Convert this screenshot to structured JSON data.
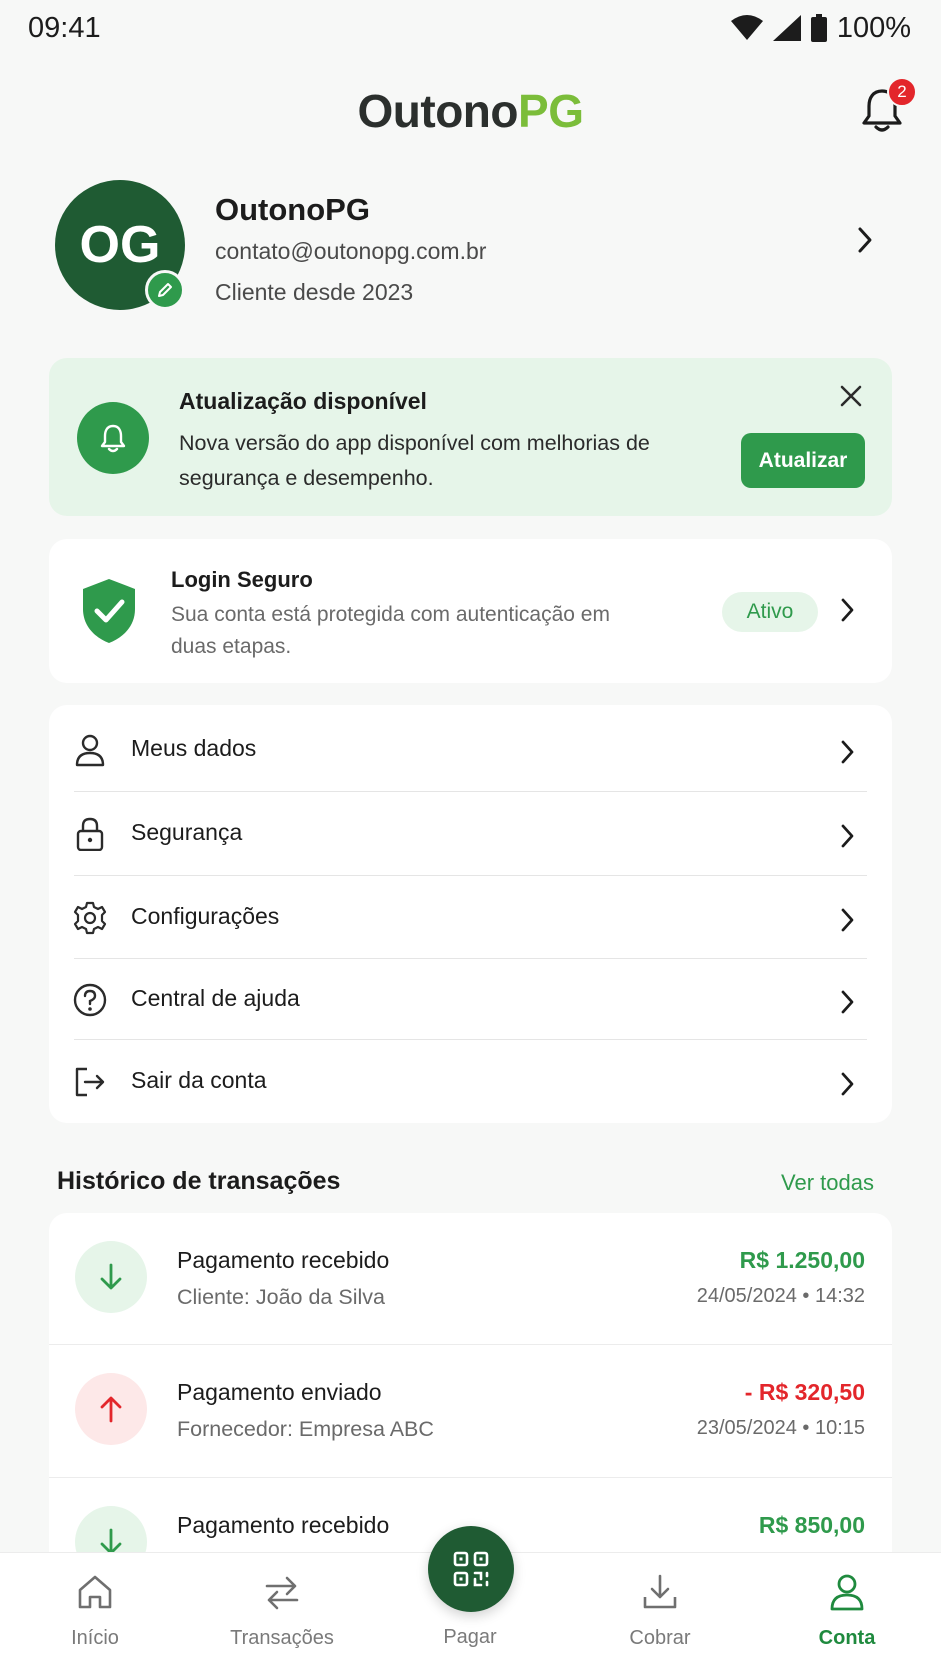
{
  "status_bar": {
    "time": "09:41",
    "battery": "100%"
  },
  "header": {
    "logo_dark": "Outono",
    "logo_green": "PG",
    "notification_count": "2"
  },
  "profile": {
    "initials": "OG",
    "name": "OutonoPG",
    "email": "contato@outonopg.com.br",
    "since": "Cliente desde 2023"
  },
  "update_card": {
    "title": "Atualização disponível",
    "text": "Nova versão do app disponível com melhorias de segurança e desempenho.",
    "button": "Atualizar"
  },
  "login_card": {
    "title": "Login Seguro",
    "text": "Sua conta está protegida com autenticação em duas etapas.",
    "badge": "Ativo"
  },
  "menu": {
    "items": [
      {
        "label": "Meus dados",
        "icon": "user-icon"
      },
      {
        "label": "Segurança",
        "icon": "lock-icon"
      },
      {
        "label": "Configurações",
        "icon": "gear-icon"
      },
      {
        "label": "Central de ajuda",
        "icon": "help-icon"
      },
      {
        "label": "Sair da conta",
        "icon": "logout-icon"
      }
    ]
  },
  "transactions": {
    "heading": "Histórico de transações",
    "see_all": "Ver todas",
    "items": [
      {
        "title": "Pagamento recebido",
        "subtitle": "Cliente: João da Silva",
        "amount": "R$ 1.250,00",
        "date": "24/05/2024 • 14:32",
        "direction": "in"
      },
      {
        "title": "Pagamento enviado",
        "subtitle": "Fornecedor: Empresa ABC",
        "amount": "- R$ 320,50",
        "date": "23/05/2024 • 10:15",
        "direction": "out"
      },
      {
        "title": "Pagamento recebido",
        "subtitle": "",
        "amount": "R$ 850,00",
        "date": "",
        "direction": "in"
      }
    ]
  },
  "bottom_nav": {
    "items": [
      {
        "label": "Início",
        "icon": "home-icon"
      },
      {
        "label": "Transações",
        "icon": "transfer-icon"
      },
      {
        "label": "Pagar",
        "icon": "qr-icon"
      },
      {
        "label": "Cobrar",
        "icon": "download-icon"
      },
      {
        "label": "Conta",
        "icon": "user-icon"
      }
    ],
    "active": "Conta"
  },
  "colors": {
    "brand_dark_green": "#1f5b33",
    "brand_green": "#2f9a4c",
    "logo_accent": "#7bbd3a",
    "negative_red": "#e3262b",
    "success_bg": "#e6f5e9"
  }
}
